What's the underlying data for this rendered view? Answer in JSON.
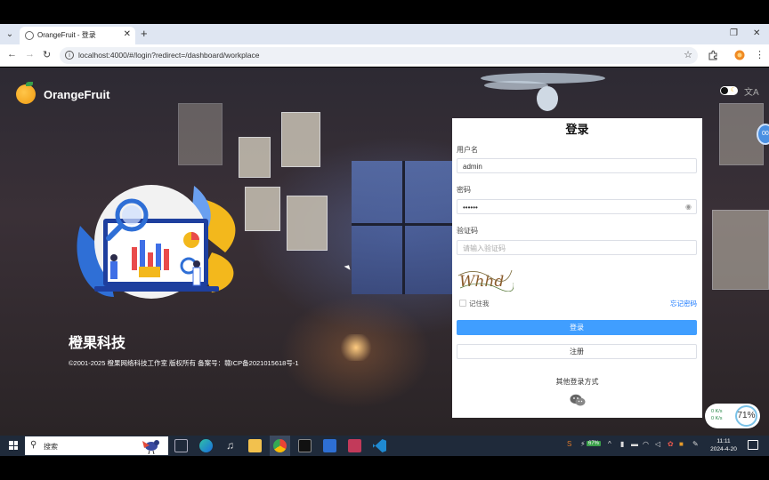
{
  "browser": {
    "tab_title": "OrangeFruit - 登录",
    "url": "localhost:4000/#/login?redirect=/dashboard/workplace"
  },
  "header": {
    "brand_name": "OrangeFruit"
  },
  "left": {
    "company_name": "橙果科技",
    "copyright": "©2001-2025 橙果网络科技工作室 版权所有 备案号：赣ICP备2021015618号-1"
  },
  "login": {
    "title": "登录",
    "username_label": "用户名",
    "username_value": "admin",
    "password_label": "密码",
    "password_value": "••••••",
    "captcha_label": "验证码",
    "captcha_placeholder": "请输入验证码",
    "captcha_text": "Whhd",
    "remember_label": "记住我",
    "forgot_label": "忘记密码",
    "login_button": "登录",
    "register_button": "注册",
    "other_login": "其他登录方式"
  },
  "widgets": {
    "side_bubble": "00",
    "net_up": "0 K/s",
    "net_down": "0 K/s",
    "net_percent": "71%"
  },
  "taskbar": {
    "search_text": "搜索",
    "battery": "67%",
    "clock_time": "11:11",
    "clock_date": "2024-4-20"
  }
}
